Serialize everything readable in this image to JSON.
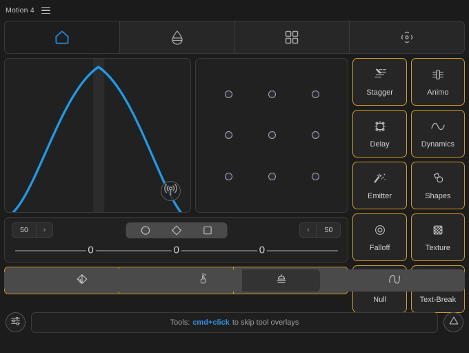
{
  "window": {
    "title": "Motion 4",
    "menu_icon": "hamburger-icon"
  },
  "tabs": [
    {
      "id": "home",
      "icon": "home-icon",
      "active": true
    },
    {
      "id": "droplet",
      "icon": "droplet-icon",
      "active": false
    },
    {
      "id": "grid",
      "icon": "grid-icon",
      "active": false
    },
    {
      "id": "transform",
      "icon": "move-icon",
      "active": false
    }
  ],
  "curve_panel": {
    "badge_icon": "broadcast-icon",
    "curve_color": "#1e9ae6",
    "playhead_color": "#2b2b2b"
  },
  "anchor_panel": {
    "rows": 3,
    "cols": 3,
    "points": [
      "top-left",
      "top-center",
      "top-right",
      "middle-left",
      "middle-center",
      "middle-right",
      "bottom-left",
      "bottom-center",
      "bottom-right"
    ]
  },
  "controls": {
    "left_stepper": {
      "value": "50",
      "chevron": "›"
    },
    "right_stepper": {
      "value": "50",
      "chevron": "‹"
    },
    "shape_selector": [
      {
        "id": "circle",
        "icon": "circle-icon"
      },
      {
        "id": "diamond",
        "icon": "diamond-icon"
      },
      {
        "id": "square",
        "icon": "square-icon"
      }
    ],
    "sliders": [
      {
        "id": "slider-1",
        "value": "0",
        "percent": 24
      },
      {
        "id": "slider-2",
        "value": "0",
        "percent": 50
      },
      {
        "id": "slider-3",
        "value": "0",
        "percent": 76
      }
    ]
  },
  "segment_bar": [
    {
      "id": "duplicate",
      "icon": "duplicate-icon"
    },
    {
      "id": "anchor",
      "icon": "anchor-icon"
    },
    {
      "id": "distribute",
      "icon": "signpost-icon"
    }
  ],
  "tools": [
    {
      "id": "stagger",
      "label": "Stagger",
      "icon": "stagger-icon"
    },
    {
      "id": "animo",
      "label": "Animo",
      "icon": "animo-icon"
    },
    {
      "id": "delay",
      "label": "Delay",
      "icon": "delay-icon"
    },
    {
      "id": "dynamics",
      "label": "Dynamics",
      "icon": "wave-icon"
    },
    {
      "id": "emitter",
      "label": "Emitter",
      "icon": "sparkle-icon"
    },
    {
      "id": "shapes",
      "label": "Shapes",
      "icon": "shapes-icon"
    },
    {
      "id": "falloff",
      "label": "Falloff",
      "icon": "target-icon"
    },
    {
      "id": "texture",
      "label": "Texture",
      "icon": "crosshatch-icon"
    },
    {
      "id": "null",
      "label": "Null",
      "icon": "null-icon"
    },
    {
      "id": "textbreak",
      "label": "Text-Break",
      "icon": "text-break-icon"
    }
  ],
  "bottom_toolbar": [
    {
      "id": "fan",
      "icon": "fan-icon",
      "active": false
    },
    {
      "id": "touch",
      "icon": "touch-icon",
      "active": false
    },
    {
      "id": "stack",
      "icon": "stack-icon",
      "active": true
    },
    {
      "id": "curve",
      "icon": "curve-icon",
      "active": false
    }
  ],
  "status_bar": {
    "left_icon": "sliders-icon",
    "right_icon": "triangle-icon",
    "prefix": "Tools:",
    "highlight": "cmd+click",
    "suffix": "to skip tool overlays"
  },
  "colors": {
    "accent_orange": "#d19b27",
    "accent_blue": "#1e9ae6",
    "link_blue": "#2e90e0",
    "panel_bg": "#212121",
    "window_bg": "#1b1b1b",
    "button_bg": "#4a4a4a"
  }
}
